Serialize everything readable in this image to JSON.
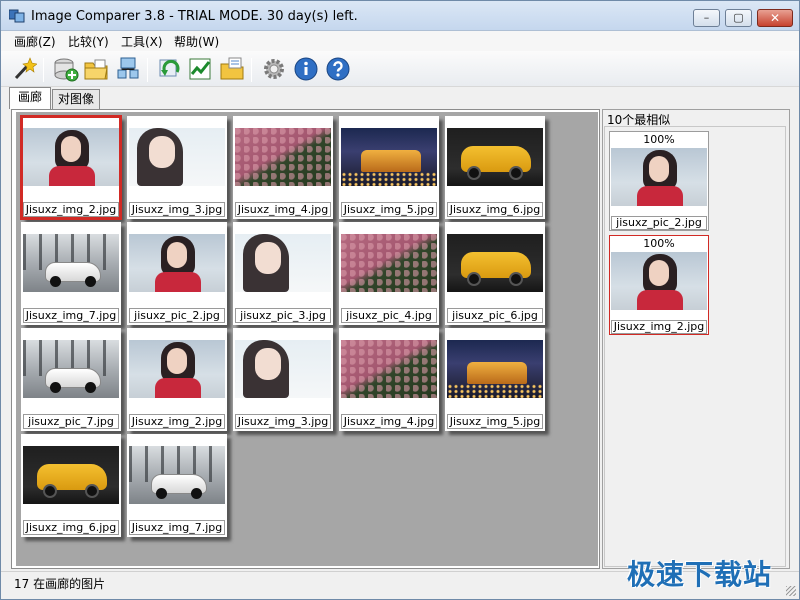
{
  "window": {
    "title": "Image Comparer 3.8 - TRIAL MODE. 30 day(s) left.",
    "minimize": "–",
    "maximize": "▢",
    "close": "✕"
  },
  "menu": [
    "画廊(Z)",
    "比较(Y)",
    "工具(X)",
    "帮助(W)"
  ],
  "toolbar": [
    {
      "name": "wizard-wand-icon"
    },
    {
      "name": "add-disk-icon"
    },
    {
      "name": "open-folder-icon"
    },
    {
      "name": "network-scan-icon"
    },
    {
      "name": "refresh-compare-icon"
    },
    {
      "name": "chart-check-icon"
    },
    {
      "name": "folder-sync-icon"
    },
    {
      "name": "settings-gear-icon"
    },
    {
      "name": "info-icon"
    },
    {
      "name": "help-icon"
    }
  ],
  "tabs": [
    "画廊",
    "对图像"
  ],
  "gallery": {
    "items": [
      {
        "file": "Jisuxz_img_2.jpg",
        "art": "woman",
        "selected": true
      },
      {
        "file": "Jisuxz_img_3.jpg",
        "art": "woman2"
      },
      {
        "file": "Jisuxz_img_4.jpg",
        "art": "flower"
      },
      {
        "file": "Jisuxz_img_5.jpg",
        "art": "castle"
      },
      {
        "file": "Jisuxz_img_6.jpg",
        "art": "car-y"
      },
      {
        "file": "Jisuxz_img_7.jpg",
        "art": "car-w"
      },
      {
        "file": "jisuxz_pic_2.jpg",
        "art": "woman"
      },
      {
        "file": "jisuxz_pic_3.jpg",
        "art": "woman2"
      },
      {
        "file": "jisuxz_pic_4.jpg",
        "art": "flower"
      },
      {
        "file": "jisuxz_pic_6.jpg",
        "art": "car-y"
      },
      {
        "file": "jisuxz_pic_7.jpg",
        "art": "car-w"
      },
      {
        "file": "Jisuxz_img_2.jpg",
        "art": "woman"
      },
      {
        "file": "Jisuxz_img_3.jpg",
        "art": "woman2"
      },
      {
        "file": "Jisuxz_img_4.jpg",
        "art": "flower"
      },
      {
        "file": "Jisuxz_img_5.jpg",
        "art": "castle"
      },
      {
        "file": "Jisuxz_img_6.jpg",
        "art": "car-y"
      },
      {
        "file": "Jisuxz_img_7.jpg",
        "art": "car-w"
      }
    ]
  },
  "similar": {
    "header": "10个最相似",
    "items": [
      {
        "percent": "100%",
        "file": "jisuxz_pic_2.jpg",
        "selected": false
      },
      {
        "percent": "100%",
        "file": "Jisuxz_img_2.jpg",
        "selected": true
      }
    ]
  },
  "status": {
    "text": "17 在画廊的图片",
    "watermark": "极速下载站"
  },
  "colors": {
    "selection": "#d12a25",
    "gallery_bg": "#a6a6a6",
    "watermark": "#1f6fb6"
  }
}
